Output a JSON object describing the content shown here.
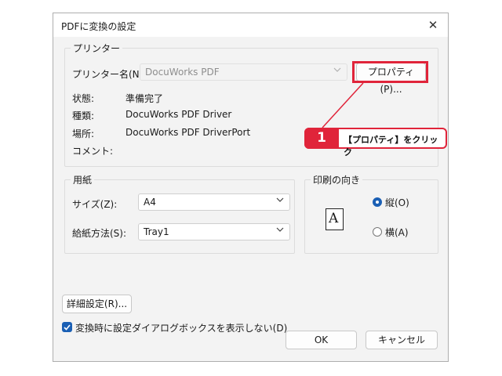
{
  "window": {
    "title": "PDFに変換の設定",
    "close_icon": "close-icon"
  },
  "printer": {
    "group_label": "プリンター",
    "name_label": "プリンター名(N):",
    "name_value": "DocuWorks PDF",
    "properties_button": "プロパティ(P)...",
    "status_label": "状態:",
    "status_value": "準備完了",
    "type_label": "種類:",
    "type_value": "DocuWorks PDF Driver",
    "location_label": "場所:",
    "location_value": "DocuWorks PDF DriverPort",
    "comment_label": "コメント:"
  },
  "paper": {
    "group_label": "用紙",
    "size_label": "サイズ(Z):",
    "size_value": "A4",
    "source_label": "給紙方法(S):",
    "source_value": "Tray1"
  },
  "orientation": {
    "group_label": "印刷の向き",
    "icon_glyph": "A",
    "portrait_label": "縦(O)",
    "landscape_label": "横(A)",
    "selected": "portrait"
  },
  "footer": {
    "advanced_button": "詳細設定(R)...",
    "checkbox_label": "変換時に設定ダイアログボックスを表示しない(D)",
    "checkbox_checked": true,
    "ok_button": "OK",
    "cancel_button": "キャンセル"
  },
  "annotation": {
    "step_number": "1",
    "text": "【プロパティ】をクリック",
    "color": "#e0243a"
  }
}
